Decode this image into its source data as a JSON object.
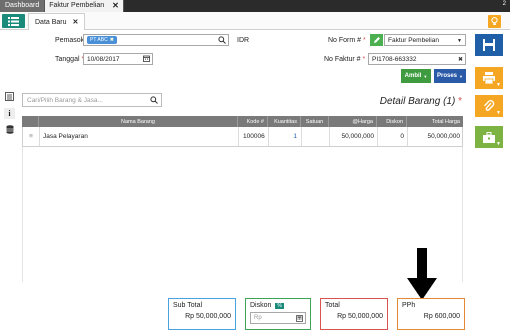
{
  "topbar": {
    "tabs": [
      "Dashboard",
      "Faktur Pembelian"
    ],
    "close": "✕",
    "count": "2"
  },
  "subtab": {
    "label": "Data Baru",
    "close": "✕"
  },
  "form": {
    "pemasok_label": "Pemasok",
    "pemasok_value": "PT ABC",
    "tanggal_label": "Tanggal",
    "tanggal_value": "10/08/2017",
    "currency": "IDR",
    "no_form_label": "No Form #",
    "no_form_value": "Faktur Pembelian",
    "no_faktur_label": "No Faktur #",
    "no_faktur_value": "PI1708-663332",
    "required_mark": "*"
  },
  "buttons": {
    "ambil": "Ambil",
    "proses": "Proses"
  },
  "table": {
    "search_placeholder": "Cari/Pilih Barang & Jasa...",
    "title": "Detail Barang (1)",
    "headers": [
      "Nama Barang",
      "Kode #",
      "Kuantitas",
      "Satuan",
      "@Harga",
      "Diskon",
      "Total Harga"
    ],
    "rows": [
      {
        "handle": "≡",
        "name": "Jasa Pelayaran",
        "code": "100006",
        "qty": "1",
        "unit": "",
        "price": "50,000,000",
        "discount": "0",
        "total": "50,000,000"
      }
    ]
  },
  "summary": {
    "subtotal_label": "Sub Total",
    "subtotal_value": "Rp 50,000,000",
    "diskon_label": "Diskon",
    "diskon_placeholder": "Rp",
    "total_label": "Total",
    "total_value": "Rp 50,000,000",
    "pph_label": "PPh",
    "pph_value": "Rp 600,000"
  },
  "colors": {
    "teal": "#1a8a7a",
    "save": "#1f5fa8",
    "orange": "#f5a623",
    "green": "#7cb342",
    "required": "#d9534f"
  }
}
